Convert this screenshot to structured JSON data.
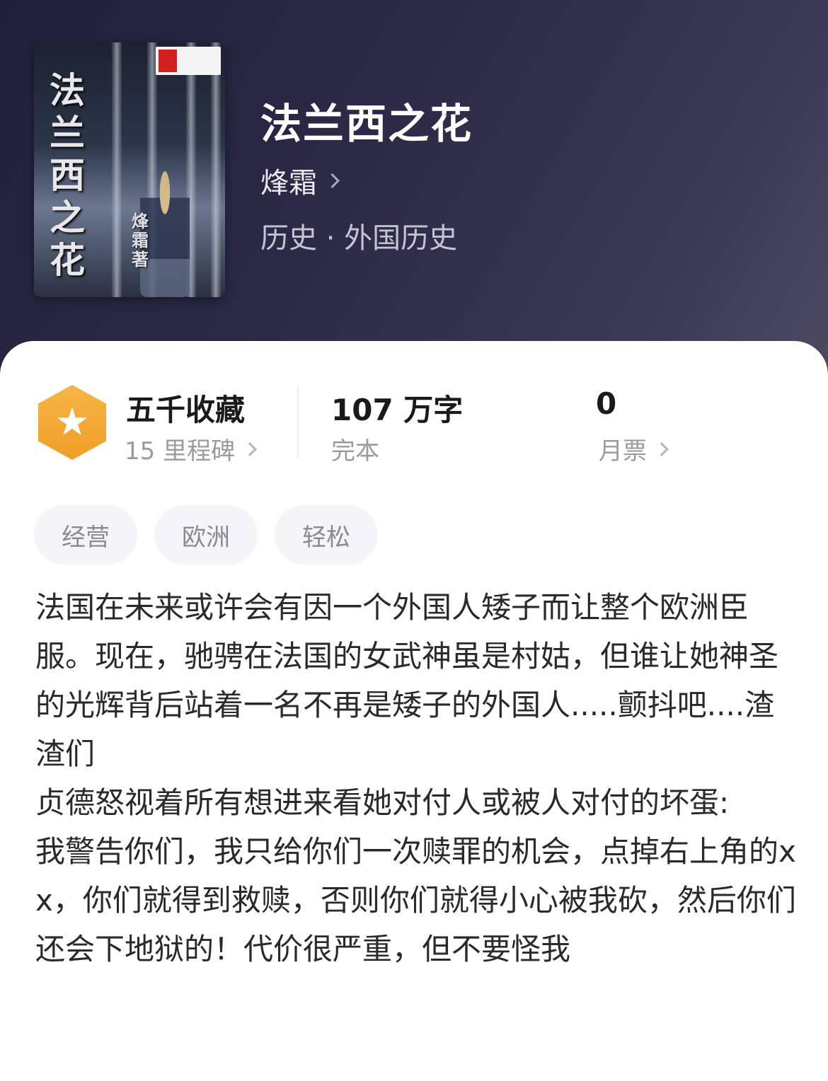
{
  "book": {
    "title": "法兰西之花",
    "author": "烽霜",
    "category": "历史 · 外国历史",
    "cover": {
      "title_text": "法兰西之花",
      "author_text": "烽霜著"
    }
  },
  "stats": {
    "collection": {
      "title": "五千收藏",
      "sub": "15 里程碑",
      "icon": "star-hexagon-icon"
    },
    "words": {
      "title": "107 万字",
      "sub": "完本"
    },
    "tickets": {
      "title": "0",
      "sub": "月票"
    }
  },
  "tags": [
    "经营",
    "欧洲",
    "轻松"
  ],
  "synopsis": "法国在未来或许会有因一个外国人矮子而让整个欧洲臣服。现在，驰骋在法国的女武神虽是村姑，但谁让她神圣的光辉背后站着一名不再是矮子的外国人.....颤抖吧....渣渣们\n贞德怒视着所有想进来看她对付人或被人对付的坏蛋:\n我警告你们，我只给你们一次赎罪的机会，点掉右上角的xx，你们就得到救赎，否则你们就得小心被我砍，然后你们还会下地狱的！代价很严重，但不要怪我",
  "colors": {
    "header_bg": "#2b2b47",
    "badge_gradient_top": "#f7b546",
    "badge_gradient_bottom": "#f09e27",
    "tag_bg": "#f5f5f7"
  }
}
